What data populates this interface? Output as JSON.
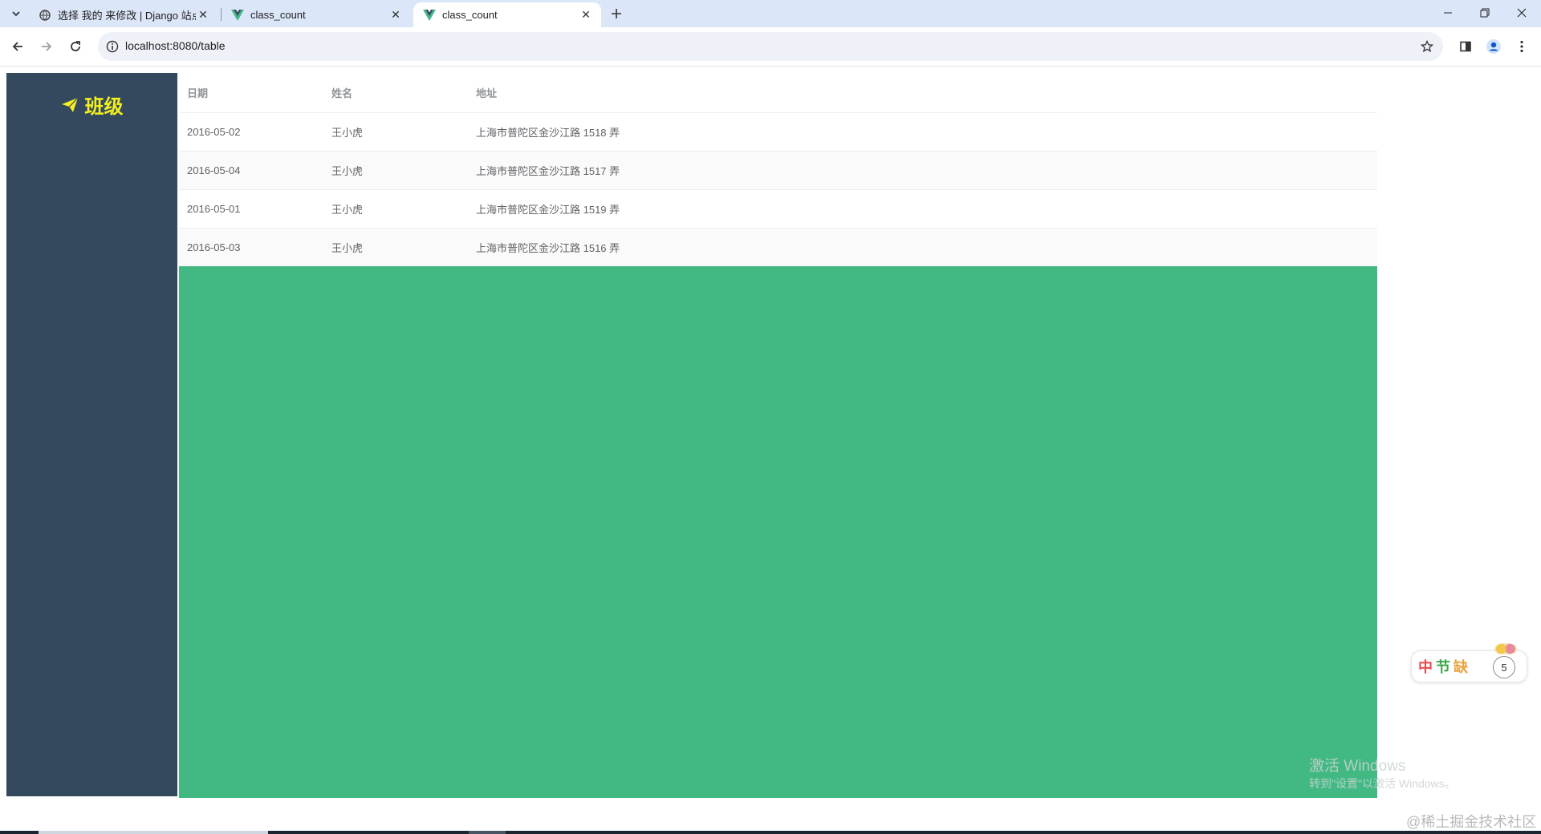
{
  "browser": {
    "tabs": [
      {
        "title": "选择 我的 来修改 | Django 站点",
        "favicon": "globe-icon",
        "active": false
      },
      {
        "title": "class_count",
        "favicon": "vue-icon",
        "active": false
      },
      {
        "title": "class_count",
        "favicon": "vue-icon",
        "active": true
      }
    ],
    "url": "localhost:8080/table"
  },
  "app": {
    "brand_title": "班级",
    "brand_icon": "paper-plane-icon",
    "brand_color": "#f4ef1f",
    "sidebar_color": "#34495e",
    "content_color": "#42b983"
  },
  "table": {
    "headers": [
      "日期",
      "姓名",
      "地址"
    ],
    "rows": [
      {
        "date": "2016-05-02",
        "name": "王小虎",
        "address": "上海市普陀区金沙江路 1518 弄"
      },
      {
        "date": "2016-05-04",
        "name": "王小虎",
        "address": "上海市普陀区金沙江路 1517 弄"
      },
      {
        "date": "2016-05-01",
        "name": "王小虎",
        "address": "上海市普陀区金沙江路 1519 弄"
      },
      {
        "date": "2016-05-03",
        "name": "王小虎",
        "address": "上海市普陀区金沙江路 1516 弄"
      }
    ]
  },
  "overlays": {
    "festival_text": [
      "中",
      "节",
      "缺"
    ],
    "festival_badge": "5",
    "activation_title": "激活 Windows",
    "activation_sub": "转到\"设置\"以激活 Windows。",
    "juejin_watermark": "@稀土掘金技术社区"
  }
}
